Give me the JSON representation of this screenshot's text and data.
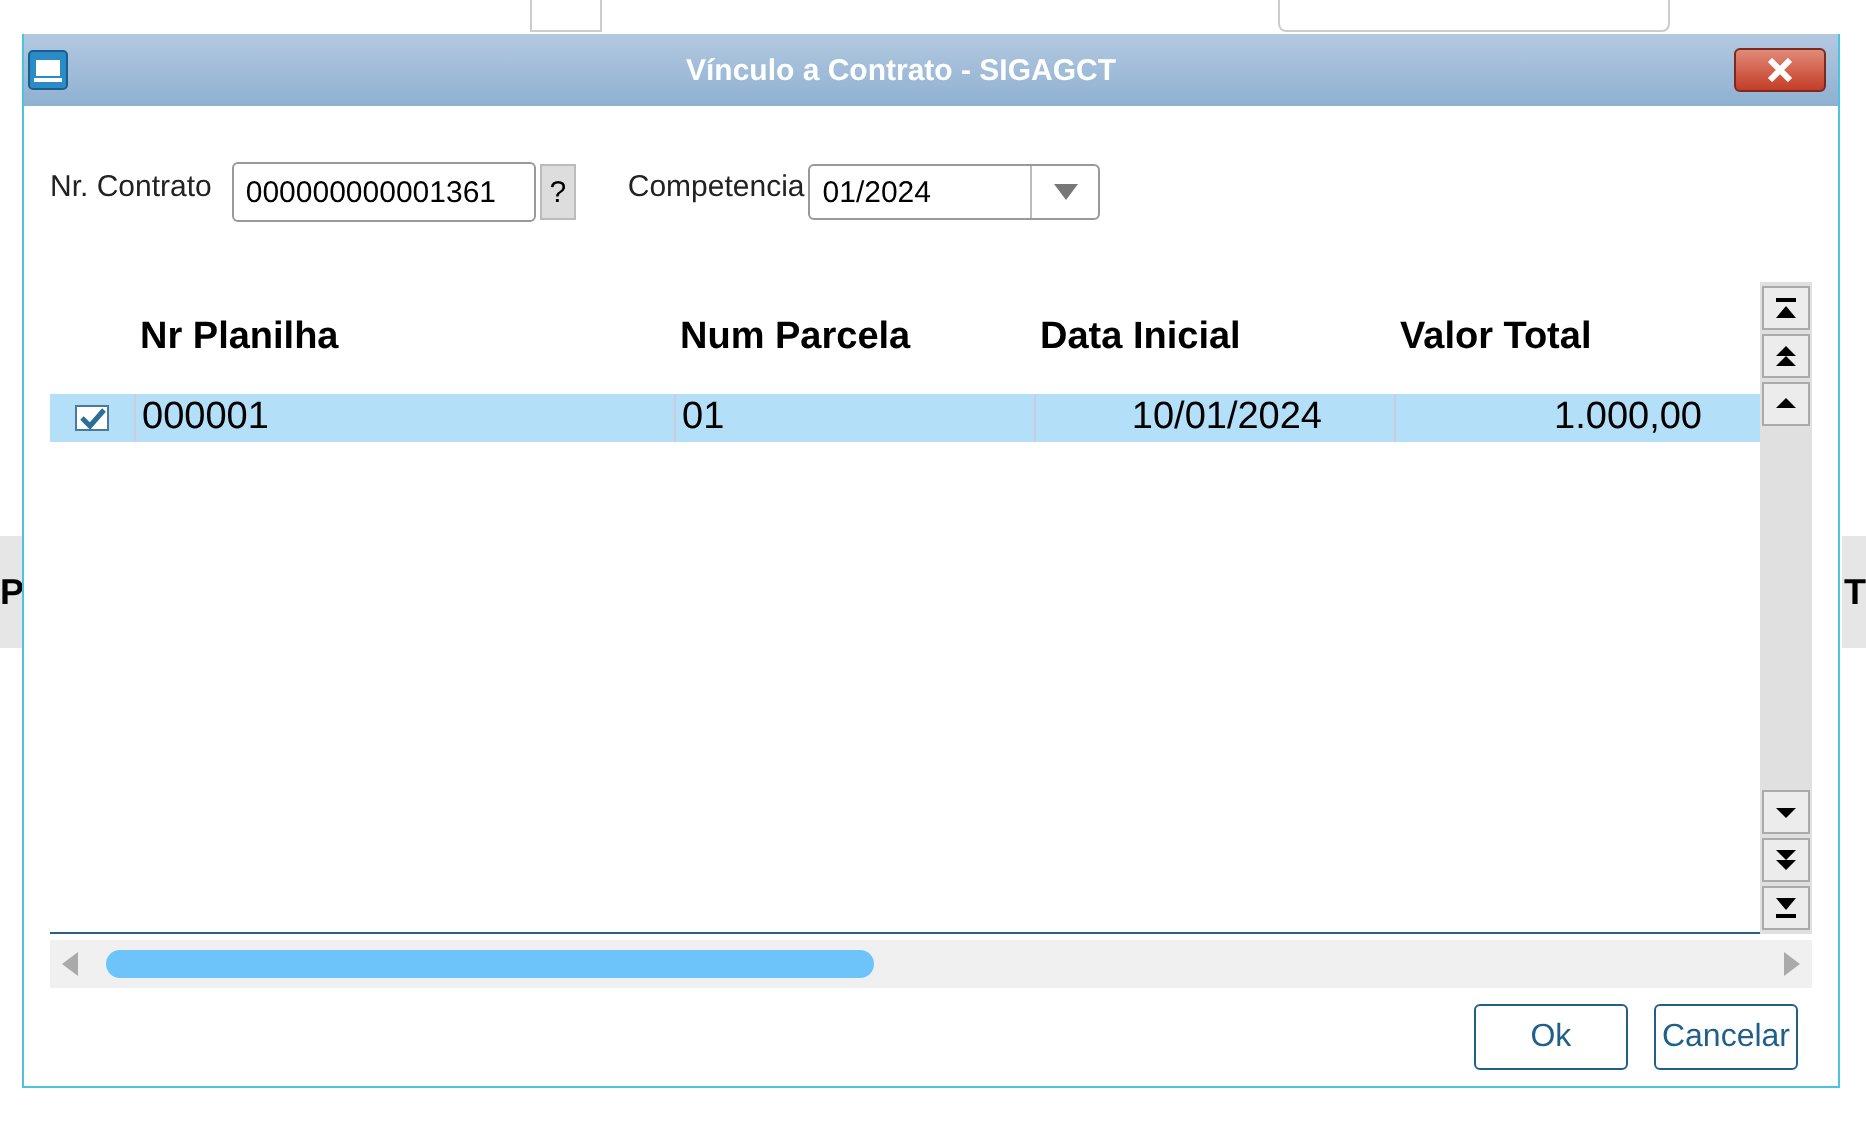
{
  "background": {
    "fragments": [
      "P",
      "T"
    ]
  },
  "window": {
    "title": "Vínculo a Contrato - SIGAGCT"
  },
  "form": {
    "contract_label": "Nr. Contrato",
    "contract_value": "000000000001361",
    "lookup_button": "?",
    "period_label": "Competencia",
    "period_value": "01/2024"
  },
  "table": {
    "columns": [
      "Nr Planilha",
      "Num Parcela",
      "Data Inicial",
      "Valor Total"
    ],
    "rows": [
      {
        "checked": true,
        "selected": true,
        "cells": [
          "000001",
          "01",
          "10/01/2024",
          "1.000,00"
        ]
      }
    ]
  },
  "buttons": [
    "Ok",
    "Cancelar"
  ]
}
